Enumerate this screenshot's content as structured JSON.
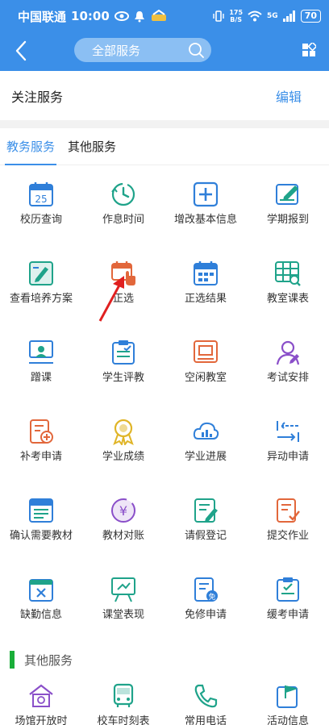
{
  "status_bar": {
    "carrier": "中国联通",
    "time": "10:00",
    "net_speed_top": "175",
    "net_speed_bottom": "B/S",
    "signal": "5G",
    "battery": "70"
  },
  "nav": {
    "search_label": "全部服务"
  },
  "follow": {
    "title": "关注服务",
    "edit_label": "编辑"
  },
  "tabs": [
    {
      "label": "教务服务",
      "active": true
    },
    {
      "label": "其他服务",
      "active": false
    }
  ],
  "services": [
    {
      "label": "校历查询",
      "icon": "calendar-icon"
    },
    {
      "label": "作息时间",
      "icon": "clock-icon"
    },
    {
      "label": "增改基本信息",
      "icon": "plus-square-icon"
    },
    {
      "label": "学期报到",
      "icon": "edit-form-icon"
    },
    {
      "label": "查看培养方案",
      "icon": "plan-edit-icon"
    },
    {
      "label": "正选",
      "icon": "select-calendar-icon"
    },
    {
      "label": "正选结果",
      "icon": "result-calendar-icon"
    },
    {
      "label": "教室课表",
      "icon": "classroom-table-icon"
    },
    {
      "label": "蹭课",
      "icon": "projector-icon"
    },
    {
      "label": "学生评教",
      "icon": "evaluation-icon"
    },
    {
      "label": "空闲教室",
      "icon": "free-room-icon"
    },
    {
      "label": "考试安排",
      "icon": "exam-user-icon"
    },
    {
      "label": "补考申请",
      "icon": "retake-doc-icon"
    },
    {
      "label": "学业成绩",
      "icon": "medal-icon"
    },
    {
      "label": "学业进展",
      "icon": "cloud-chart-icon"
    },
    {
      "label": "异动申请",
      "icon": "transfer-arrows-icon"
    },
    {
      "label": "确认需要教材",
      "icon": "book-list-icon"
    },
    {
      "label": "教材对账",
      "icon": "yuan-coin-icon"
    },
    {
      "label": "请假登记",
      "icon": "leave-note-icon"
    },
    {
      "label": "提交作业",
      "icon": "homework-check-icon"
    },
    {
      "label": "缺勤信息",
      "icon": "absence-x-icon"
    },
    {
      "label": "课堂表现",
      "icon": "classroom-board-icon"
    },
    {
      "label": "免修申请",
      "icon": "exempt-doc-icon"
    },
    {
      "label": "缓考申请",
      "icon": "defer-exam-icon"
    }
  ],
  "other_section": {
    "title": "其他服务"
  },
  "other_services": [
    {
      "label": "场馆开放时",
      "icon": "venue-house-icon"
    },
    {
      "label": "校车时刻表",
      "icon": "bus-icon"
    },
    {
      "label": "常用电话",
      "icon": "phone-icon"
    },
    {
      "label": "活动信息",
      "icon": "flag-doc-icon"
    }
  ],
  "colors": {
    "primary": "#3b8fe8",
    "icon_blue": "#2f7fd9",
    "icon_teal": "#1fa38a",
    "icon_orange": "#e2673b",
    "icon_purple": "#8a4fc9",
    "icon_yellow": "#e0b528",
    "accent_green": "#1aae39",
    "arrow_red": "#e02020"
  }
}
